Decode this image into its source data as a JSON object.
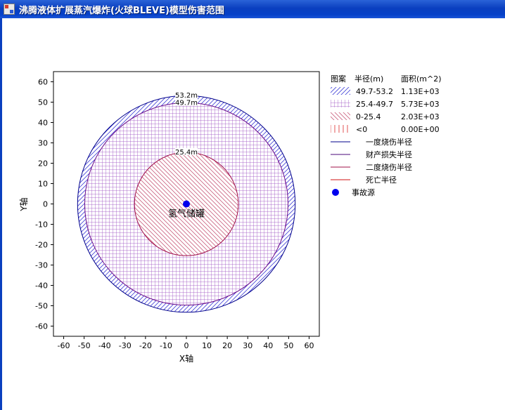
{
  "window": {
    "title": "沸腾液体扩展蒸汽爆炸(火球BLEVE)模型伤害范围"
  },
  "chart_data": {
    "type": "scatter",
    "xlabel": "X轴",
    "ylabel": "Y轴",
    "xlim": [
      -65,
      65
    ],
    "ylim": [
      -65,
      65
    ],
    "xticks": [
      -60,
      -50,
      -40,
      -30,
      -20,
      -10,
      0,
      10,
      20,
      30,
      40,
      50,
      60
    ],
    "yticks": [
      60,
      50,
      40,
      30,
      20,
      10,
      0,
      -10,
      -20,
      -30,
      -40,
      -50,
      -60
    ],
    "grid": false,
    "legend_position": "right",
    "circles": [
      {
        "radius": 53.2,
        "label": "53.2m",
        "stroke": "#00008b",
        "pattern": "hatch-blue"
      },
      {
        "radius": 49.7,
        "label": "49.7m",
        "stroke": "#6b0d8c",
        "pattern": "grid-purple"
      },
      {
        "radius": 25.4,
        "label": "25.4m",
        "stroke": "#a0104a",
        "pattern": "hatch-pink"
      }
    ],
    "source": {
      "x": 0,
      "y": 0,
      "label": "氢气储罐",
      "color": "#0000ee"
    },
    "legend": {
      "headers": [
        "图案",
        "半径(m)",
        "面积(m^2)"
      ],
      "rows": [
        {
          "range": "49.7-53.2",
          "area": "1.13E+03",
          "pattern": "hatch-blue"
        },
        {
          "range": "25.4-49.7",
          "area": "5.73E+03",
          "pattern": "grid-purple"
        },
        {
          "range": "0-25.4",
          "area": "2.03E+03",
          "pattern": "hatch-pink"
        },
        {
          "range": "<0",
          "area": "0.00E+00",
          "pattern": "vlines-red"
        }
      ],
      "lines": [
        {
          "label": "一度烧伤半径",
          "color": "#00008b"
        },
        {
          "label": "财产损失半径",
          "color": "#4b0a7a"
        },
        {
          "label": "二度烧伤半径",
          "color": "#a0104a"
        },
        {
          "label": "死亡半径",
          "color": "#d01010"
        }
      ],
      "marker_label": "事故源"
    }
  }
}
